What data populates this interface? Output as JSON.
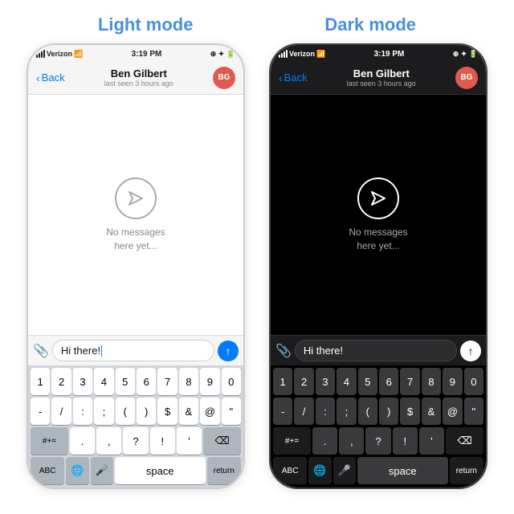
{
  "titles": {
    "light": "Light mode",
    "dark": "Dark mode"
  },
  "phone_light": {
    "status": {
      "carrier": "Verizon",
      "time": "3:19 PM",
      "wifi": true
    },
    "nav": {
      "back": "Back",
      "name": "Ben Gilbert",
      "status": "last seen 3 hours ago",
      "avatar": "BG"
    },
    "empty_message": "No messages\nhere yet...",
    "input_value": "Hi there!",
    "attach_icon": "📎",
    "send_icon": "↑"
  },
  "phone_dark": {
    "status": {
      "carrier": "Verizon",
      "time": "3:19 PM"
    },
    "nav": {
      "back": "Back",
      "name": "Ben Gilbert",
      "status": "last seen 3 hours ago",
      "avatar": "BG"
    },
    "empty_message": "No messages\nhere yet...",
    "input_value": "Hi there!",
    "send_icon": "↑"
  },
  "keyboard": {
    "row1": [
      "1",
      "2",
      "3",
      "4",
      "5",
      "6",
      "7",
      "8",
      "9",
      "0"
    ],
    "row2": [
      "-",
      "/",
      ":",
      ";",
      "(",
      ")",
      "$",
      "&",
      "@",
      "\""
    ],
    "row3_left": "#+=",
    "row3_mid": [
      ".",
      ",",
      "?",
      "!",
      "'"
    ],
    "row3_right": "⌫",
    "row4": [
      "ABC",
      "🌐",
      "🎤",
      "space",
      "return"
    ]
  },
  "colors": {
    "accent": "#007aff",
    "avatar_bg": "#e05a4e"
  }
}
